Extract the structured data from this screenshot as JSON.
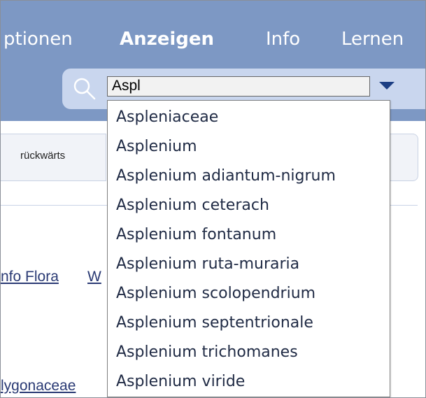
{
  "nav": {
    "items": [
      {
        "label": "ptionen"
      },
      {
        "label": "Anzeigen"
      },
      {
        "label": "Info"
      },
      {
        "label": "Lernen"
      }
    ]
  },
  "search": {
    "value": "Aspl",
    "icon": "search-icon",
    "dropdown_icon": "chevron-down-icon"
  },
  "toolbar": {
    "back_label": "rückwärts"
  },
  "content": {
    "links": [
      "nfo Flora",
      "W",
      "lygonaceae"
    ]
  },
  "suggestions": [
    "Aspleniaceae",
    "Asplenium",
    "Asplenium adiantum-nigrum",
    "Asplenium ceterach",
    "Asplenium fontanum",
    "Asplenium ruta-muraria",
    "Asplenium scolopendrium",
    "Asplenium septentrionale",
    "Asplenium trichomanes",
    "Asplenium viride"
  ],
  "colors": {
    "topbar": "#7d98c4",
    "search_panel": "#c9d6ee",
    "link": "#2a3a74"
  }
}
